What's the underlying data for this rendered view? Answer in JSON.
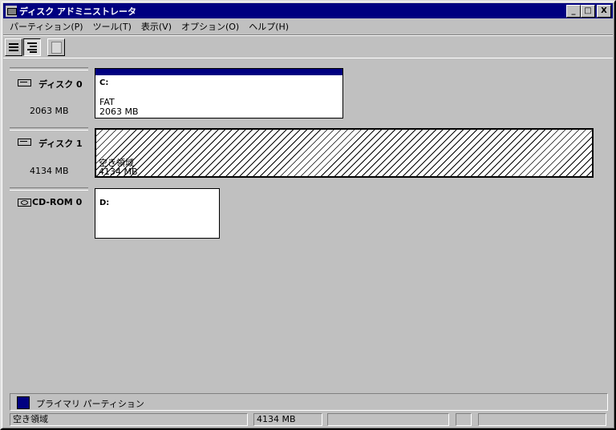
{
  "window": {
    "title": "ディスク アドミニストレータ"
  },
  "titlebar_buttons": {
    "minimize": "_",
    "maximize": "□",
    "close": "X"
  },
  "menu": [
    {
      "label": "パーティション(P)"
    },
    {
      "label": "ツール(T)"
    },
    {
      "label": "表示(V)"
    },
    {
      "label": "オプション(O)"
    },
    {
      "label": "ヘルプ(H)"
    }
  ],
  "toolbar": {
    "buttons": [
      {
        "icon": "volumes-view-icon"
      },
      {
        "icon": "disk-configuration-view-icon"
      },
      {
        "icon": "properties-icon"
      }
    ]
  },
  "disks": [
    {
      "name": "ディスク 0",
      "size": "2063 MB",
      "partitions": [
        {
          "type": "primary",
          "drive": "C:",
          "fs": "FAT",
          "size": "2063 MB"
        }
      ]
    },
    {
      "name": "ディスク 1",
      "size": "4134 MB",
      "partitions": [
        {
          "type": "free",
          "label": "空き領域",
          "size": "4134 MB"
        }
      ]
    },
    {
      "name": "CD-ROM 0",
      "size": "",
      "partitions": [
        {
          "type": "cdrom",
          "drive": "D:"
        }
      ]
    }
  ],
  "legend": {
    "color": "#000080",
    "label": "プライマリ パーティション"
  },
  "status": {
    "panels": [
      "空き領域",
      "4134 MB",
      "",
      "",
      ""
    ]
  },
  "colors": {
    "titlebar": "#000080",
    "face": "#c0c0c0",
    "primary_partition": "#000080"
  }
}
